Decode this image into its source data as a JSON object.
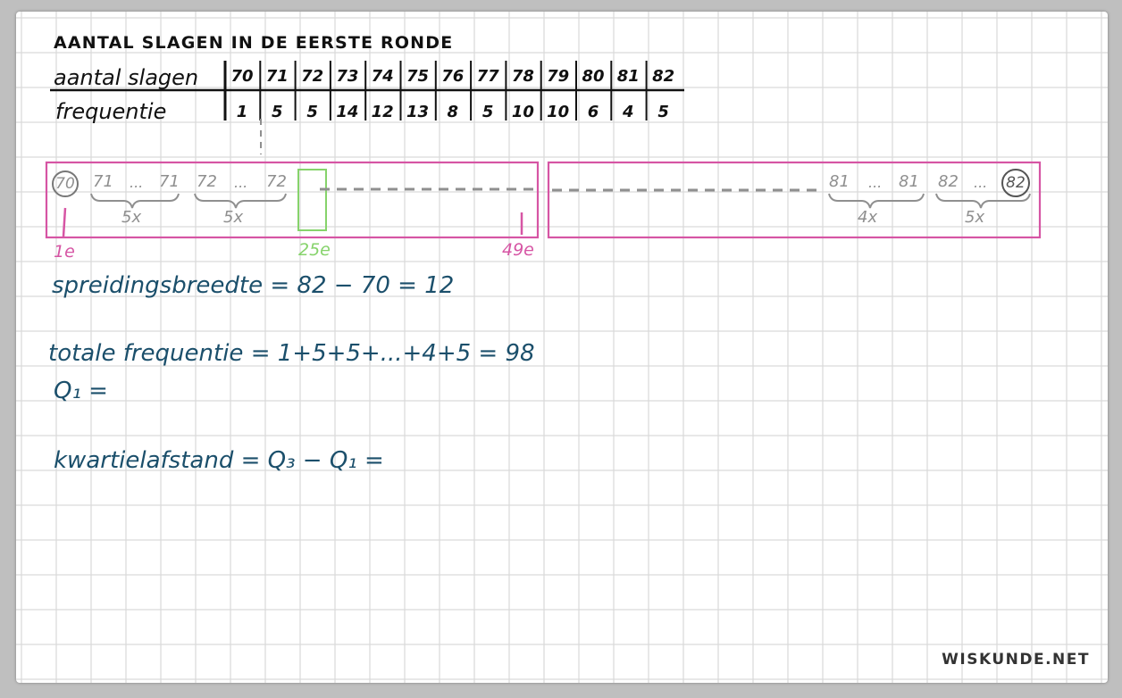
{
  "title": "AANTAL SLAGEN IN DE EERSTE RONDE",
  "table": {
    "row1_label": "aantal slagen",
    "row2_label": "frequentie",
    "values": [
      "70",
      "71",
      "72",
      "73",
      "74",
      "75",
      "76",
      "77",
      "78",
      "79",
      "80",
      "81",
      "82"
    ],
    "frequencies": [
      "1",
      "5",
      "5",
      "14",
      "12",
      "13",
      "8",
      "5",
      "10",
      "10",
      "6",
      "4",
      "5"
    ]
  },
  "diagram": {
    "first_value": "70",
    "group1": {
      "start": "71",
      "dots": "...",
      "end": "71",
      "count": "5x"
    },
    "group2": {
      "start": "72",
      "dots": "...",
      "end": "72",
      "count": "5x"
    },
    "group3": {
      "start": "81",
      "dots": "...",
      "end": "81",
      "count": "4x"
    },
    "group4": {
      "start": "82",
      "dots": "...",
      "count": "5x"
    },
    "last_value": "82",
    "label_first": "1e",
    "label_25": "25e",
    "label_49": "49e"
  },
  "equations": {
    "spreiding": "spreidingsbreedte = 82 − 70 = 12",
    "totaal": "totale frequentie = 1+5+5+...+4+5 = 98",
    "q1": "Q₁ =",
    "kwartiel": "kwartielafstand = Q₃ − Q₁ ="
  },
  "brand": "WISKUNDE.NET",
  "colors": {
    "ink": "#111111",
    "teal": "#1b4f6b",
    "pink": "#d655a4",
    "green": "#86d36b",
    "gray": "#8f8f8f"
  }
}
